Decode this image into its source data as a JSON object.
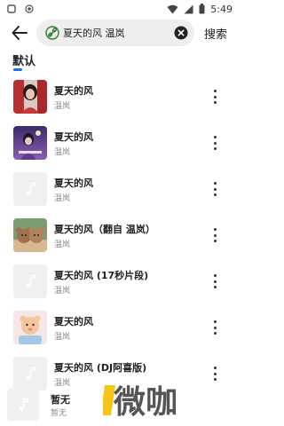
{
  "status_bar": {
    "time": "5:49"
  },
  "search": {
    "query": "夏天的风 温岚",
    "submit_label": "搜索"
  },
  "section": {
    "tab_label": "默认"
  },
  "songs": [
    {
      "title": "夏天的风",
      "artist": "温岚",
      "cover": "photo-woman-red"
    },
    {
      "title": "夏天的风",
      "artist": "温岚",
      "cover": "album-purple-night"
    },
    {
      "title": "夏天的风",
      "artist": "温岚",
      "cover": "placeholder-music-note"
    },
    {
      "title": "夏天的风（翻自 温岚）",
      "artist": "温岚",
      "cover": "teddy-bears"
    },
    {
      "title": "夏天的风 (17秒片段)",
      "artist": "温岚",
      "cover": "placeholder-music-note"
    },
    {
      "title": "夏天的风",
      "artist": "温岚",
      "cover": "cartoon-pastel"
    },
    {
      "title": "夏天的风 (DJ阿喜版)",
      "artist": "温岚",
      "cover": "placeholder-music-note"
    }
  ],
  "player": {
    "title": "暂无",
    "artist": "暂无"
  },
  "watermark": {
    "text": "微咖"
  },
  "colors": {
    "accent": "#1a73e8",
    "search_bg": "#eeeeee",
    "watermark_yellow": "#f5c518",
    "watermark_gray": "#555555"
  }
}
